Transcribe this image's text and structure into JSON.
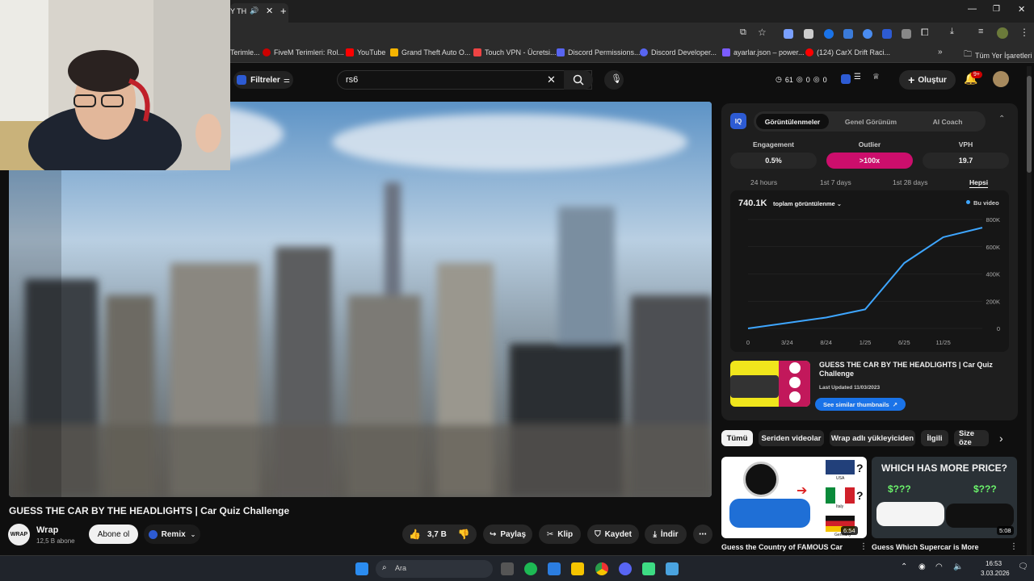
{
  "browser": {
    "tab_title": "Y TH",
    "bookmarks": [
      {
        "label": "Terimle...",
        "color": "#888"
      },
      {
        "label": "FiveM Terimleri: Rol...",
        "color": "#c00"
      },
      {
        "label": "YouTube",
        "color": "#f00"
      },
      {
        "label": "Grand Theft Auto O...",
        "color": "#f5b400"
      },
      {
        "label": "Touch VPN - Ücretsi...",
        "color": "#e44"
      },
      {
        "label": "Discord Permissions...",
        "color": "#5865f2"
      },
      {
        "label": "Discord Developer...",
        "color": "#5865f2"
      },
      {
        "label": "ayarlar.json – power...",
        "color": "#7b5cff"
      },
      {
        "label": "(124) CarX Drift Raci...",
        "color": "#f00"
      }
    ],
    "all_bookmarks": "Tüm Yer İşaretleri"
  },
  "youtube": {
    "filters_label": "Filtreler",
    "search_value": "rs6",
    "stats": {
      "a": "61",
      "b": "0",
      "c": "0"
    },
    "create_label": "Oluştur",
    "notif_badge": "9+"
  },
  "video": {
    "title": "GUESS THE CAR BY THE HEADLIGHTS | Car Quiz Challenge",
    "channel": "Wrap",
    "channel_logo": "WRAP",
    "subs": "12,5 B abone",
    "subscribe": "Abone ol",
    "remix": "Remix",
    "likes": "3,7 B",
    "share": "Paylaş",
    "clip": "Klip",
    "save": "Kaydet",
    "download": "İndir"
  },
  "panel": {
    "tabs": [
      "Görüntülenmeler",
      "Genel Görünüm",
      "AI Coach"
    ],
    "metrics": [
      {
        "label": "Engagement",
        "value": "0.5%"
      },
      {
        "label": "Outlier",
        "value": ">100x"
      },
      {
        "label": "VPH",
        "value": "19.7"
      }
    ],
    "ranges": [
      "24 hours",
      "1st 7 days",
      "1st 28 days",
      "Hepsi"
    ],
    "total": "740.1K",
    "total_label": "toplam görüntülenme",
    "legend": "Bu video",
    "thumb_title": "GUESS THE CAR BY THE HEADLIGHTS | Car Quiz Challenge",
    "last_updated": "Last Updated 11/03/2023",
    "similar_btn": "See similar thumbnails",
    "accent": "#cc0e6c",
    "line_color": "#3ea6ff"
  },
  "chart_data": {
    "type": "line",
    "x": [
      "0",
      "3/24",
      "8/24",
      "1/25",
      "6/25",
      "11/25",
      "now"
    ],
    "series": [
      {
        "name": "Bu video",
        "values": [
          0,
          40000,
          80000,
          140000,
          480000,
          670000,
          740000
        ]
      }
    ],
    "xticks": [
      "0",
      "3/24",
      "8/24",
      "1/25",
      "6/25",
      "11/25"
    ],
    "yticks": [
      "0",
      "200K",
      "400K",
      "600K",
      "800K"
    ],
    "ylim": [
      0,
      800000
    ]
  },
  "chips": [
    "Tümü",
    "Seriden videolar",
    "Wrap adlı yükleyiciden",
    "İlgili",
    "Size öze"
  ],
  "recs": [
    {
      "title": "Guess the Country of FAMOUS Car",
      "duration": "6:54",
      "flags": [
        "USA",
        "Italy",
        "Germany"
      ]
    },
    {
      "title": "Guess Which Supercar is More",
      "duration": "5:08",
      "headline": "WHICH HAS MORE PRICE?",
      "price": "$???"
    }
  ],
  "taskbar": {
    "search": "Ara",
    "time": "16:53",
    "date": "3.03.2026"
  }
}
